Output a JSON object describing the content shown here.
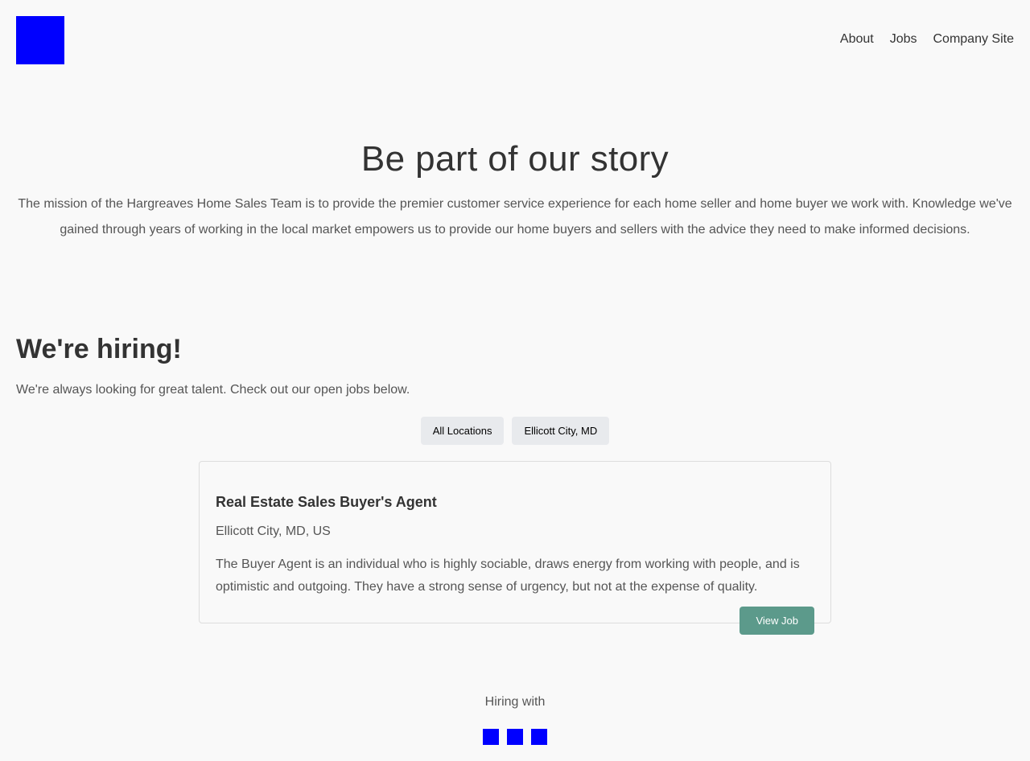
{
  "brand": {
    "logo_color": "#0000ff"
  },
  "nav": {
    "items": [
      "About",
      "Jobs",
      "Company Site"
    ]
  },
  "hero": {
    "title": "Be part of our story",
    "description": "The mission of the Hargreaves Home Sales Team is to provide the premier customer service experience for each home seller and home buyer we work with. Knowledge we've gained through years of working in the local market empowers us to provide our home buyers and sellers with the advice they need to make informed decisions."
  },
  "hiring": {
    "title": "We're hiring!",
    "subtitle": "We're always looking for great talent. Check out our open jobs below."
  },
  "filters": [
    "All Locations",
    "Ellicott City, MD"
  ],
  "jobs": [
    {
      "title": "Real Estate Sales Buyer's Agent",
      "location": "Ellicott City, MD, US",
      "description": "The Buyer Agent is an individual who is highly sociable, draws energy from working with people, and is optimistic and outgoing. They have a strong sense of urgency, but not at the expense of quality.",
      "button_label": "View Job"
    }
  ],
  "footer": {
    "hiring_with": "Hiring with",
    "social_icons": [
      "social-icon-1",
      "social-icon-2",
      "social-icon-3"
    ],
    "icon_color": "#0000ff"
  },
  "colors": {
    "background": "#f9f9f9",
    "accent": "#5c9a8b",
    "filter_bg": "#e8eaed"
  }
}
